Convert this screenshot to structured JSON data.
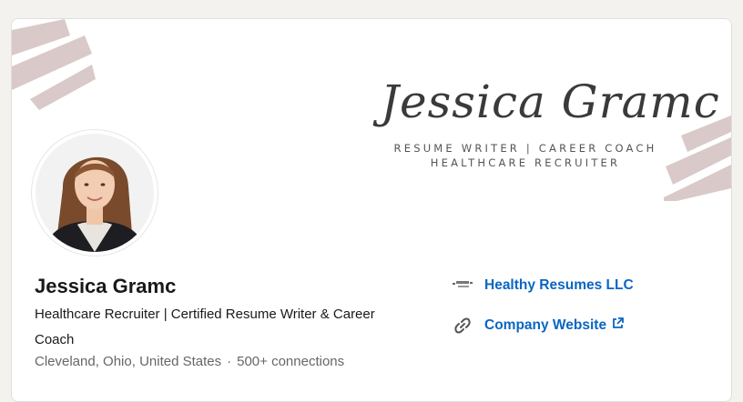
{
  "profile": {
    "name": "Jessica Gramc",
    "headline": "Healthcare Recruiter | Certified Resume Writer & Career Coach",
    "location": "Cleveland, Ohio, United States",
    "separator": "·",
    "connections": "500+ connections"
  },
  "banner": {
    "script_name": "Jessica Gramc",
    "subtitle_line1": "RESUME WRITER | CAREER COACH",
    "subtitle_line2": "HEALTHCARE RECRUITER",
    "accent_color": "#d8c7c7"
  },
  "sidebar": {
    "company": {
      "label": "Healthy Resumes LLC",
      "icon": "company-logo-icon"
    },
    "website": {
      "label": "Company Website",
      "icon": "link-icon",
      "external_icon": "external-link-icon"
    }
  },
  "colors": {
    "link": "#0a66c2",
    "text_primary": "#191919",
    "text_secondary": "#666666",
    "page_background": "#f3f2ef"
  }
}
